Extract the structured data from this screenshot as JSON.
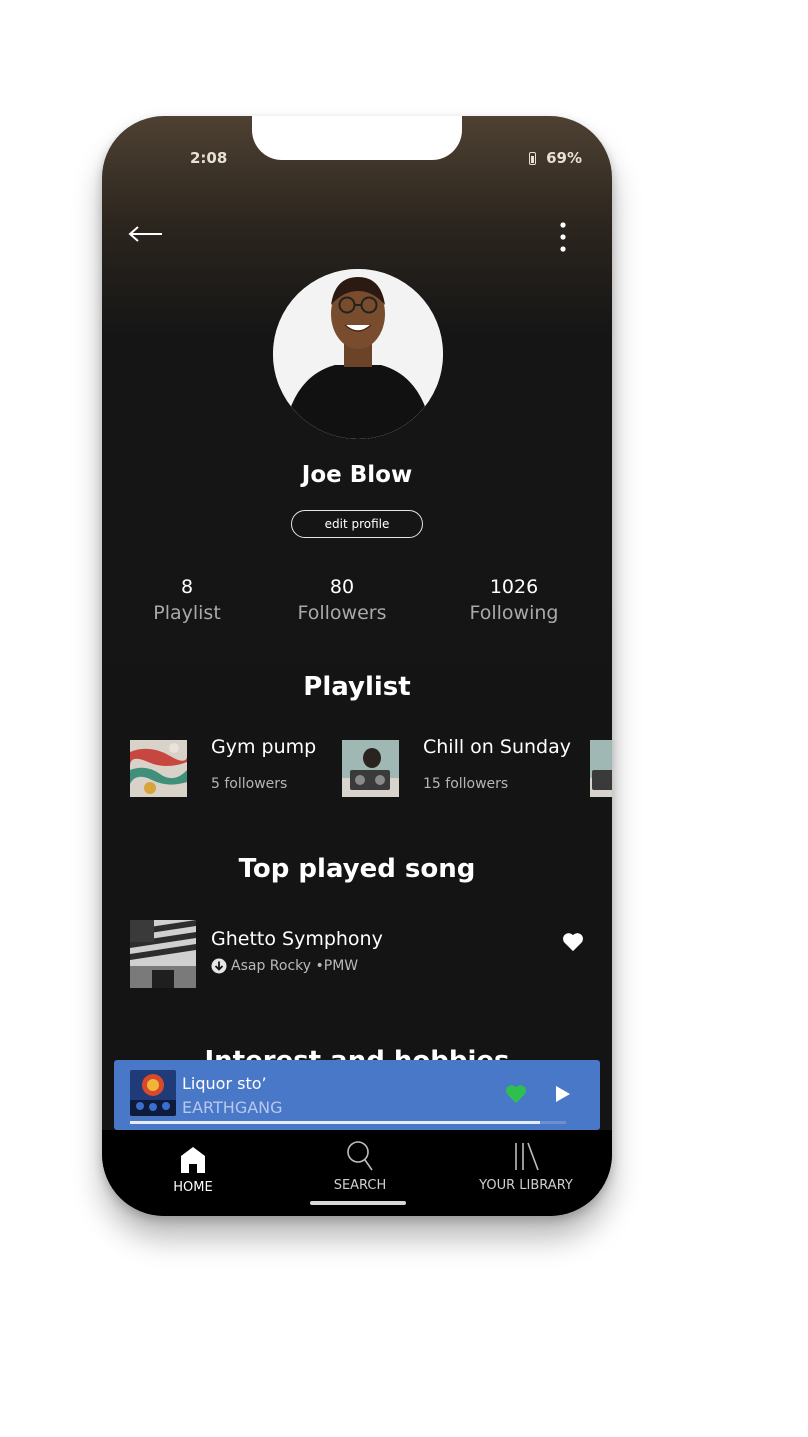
{
  "status": {
    "time": "2:08",
    "battery": "69%"
  },
  "profile": {
    "name": "Joe Blow",
    "edit_label": "edit profile",
    "stats": [
      {
        "value": "8",
        "label": "Playlist"
      },
      {
        "value": "80",
        "label": "Followers"
      },
      {
        "value": "1026",
        "label": "Following"
      }
    ]
  },
  "playlist_section": {
    "title": "Playlist",
    "items": [
      {
        "name": "Gym pump",
        "followers": "5 followers"
      },
      {
        "name": "Chill on Sunday",
        "followers": "15 followers"
      }
    ]
  },
  "top_song_section": {
    "title": "Top played song",
    "song": {
      "title": "Ghetto Symphony",
      "meta": "Asap Rocky •PMW",
      "liked": true
    }
  },
  "interests_section": {
    "title": "Interest and hobbies"
  },
  "now_playing": {
    "title": "Liquor sto’",
    "artist": "EARTHGANG",
    "progress": 0.94,
    "liked": true,
    "heart_color": "#2fbf4f"
  },
  "nav": {
    "items": [
      {
        "label": "HOME",
        "icon": "home-icon",
        "active": true
      },
      {
        "label": "SEARCH",
        "icon": "search-icon",
        "active": false
      },
      {
        "label": "YOUR LIBRARY",
        "icon": "library-icon",
        "active": false
      }
    ]
  },
  "colors": {
    "accent_blue": "#4a78c9",
    "background": "#141414"
  }
}
